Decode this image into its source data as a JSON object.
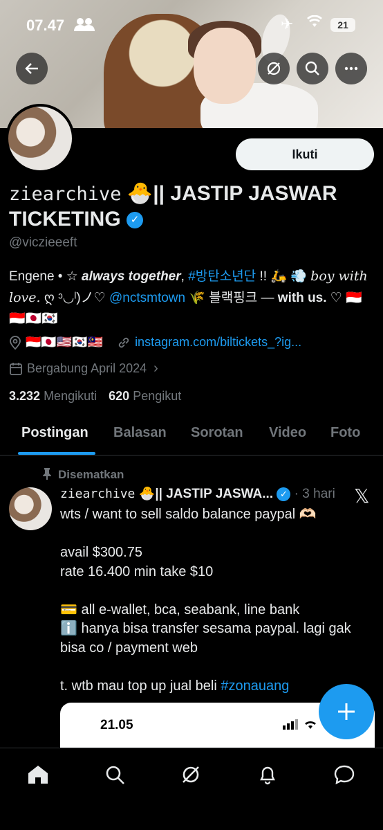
{
  "status_bar": {
    "time": "07.47",
    "battery": "21"
  },
  "header": {
    "back_icon": "back-arrow-icon",
    "grok_icon": "grok-icon",
    "search_icon": "search-icon",
    "more_icon": "more-icon"
  },
  "profile": {
    "display_name_handle_text": "ziearchive",
    "display_name_emoji": "🐣",
    "display_name_rest": "|| JASTIP JASWAR TICKETING",
    "handle": "@viczieeeft",
    "follow_label": "Ikuti",
    "bio": {
      "p1": "Engene • ☆ ",
      "p2": "always together",
      "p3": ", ",
      "hashtag": "#방탄소년단",
      "p4": " !! 🛵 💨 ",
      "p5": "boy with love.",
      "p6": " ღ ᵓ◡ˡ)ノ♡ ",
      "mention": "@nctsmtown",
      "p7": " 🌾 블랙핑크 — ",
      "p8": "with us.",
      "p9": " ♡ 🇮🇩🇮🇩🇯🇵🇰🇷"
    },
    "location": "🇮🇩🇯🇵🇺🇸🇰🇷🇲🇾",
    "website": "instagram.com/biltickets_?ig...",
    "joined": "Bergabung April 2024",
    "following_count": "3.232",
    "following_label": "Mengikuti",
    "followers_count": "620",
    "followers_label": "Pengikut"
  },
  "tabs": [
    "Postingan",
    "Balasan",
    "Sorotan",
    "Video",
    "Foto"
  ],
  "post": {
    "pinned_label": "Disematkan",
    "author_handle_text": "ziearchive",
    "author_emoji": "🐣",
    "author_rest": "|| JASTIP JASWA...",
    "time": "· 3 hari",
    "line1": "wts / want to sell saldo balance paypal 🫶🏻",
    "line2": "avail $300.75",
    "line3": "rate 16.400 min take $10",
    "line4": "💳 all e-wallet, bca, seabank, line bank",
    "line5": "ℹ️ hanya bisa transfer sesama paypal. lagi gak bisa co / payment web",
    "line6_prefix": "t. wtb mau top up jual beli ",
    "line6_hashtag": "#zonauang",
    "media_time": "21.05"
  },
  "bottom_nav": [
    "home-icon",
    "search-icon",
    "grok-icon",
    "notifications-icon",
    "messages-icon"
  ],
  "colors": {
    "accent": "#1d9bf0",
    "background": "#000000",
    "muted": "#71767b",
    "text": "#e7e9ea"
  }
}
